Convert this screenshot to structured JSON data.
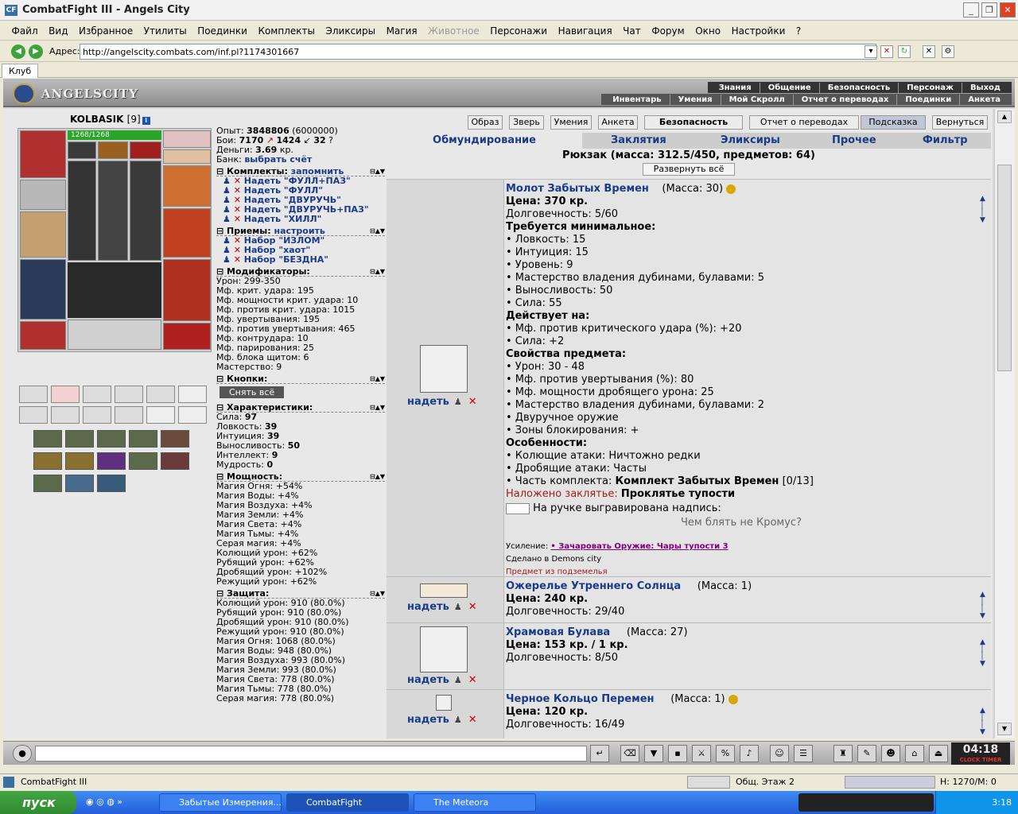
{
  "window": {
    "title": "CombatFight III - Angels City"
  },
  "menu": [
    "Файл",
    "Вид",
    "Избранное",
    "Утилиты",
    "Поединки",
    "Комплекты",
    "Эликсиры",
    "Магия",
    "Животное",
    "Персонажи",
    "Навигация",
    "Чат",
    "Форум",
    "Окно",
    "Настройки",
    "?"
  ],
  "menu_disabled": "Животное",
  "address": {
    "label": "Адрес:",
    "url": "http://angelscity.combats.com/inf.pl?1174301667"
  },
  "tab": "Клуб",
  "logo": "ANGELSCITY",
  "topnav1": [
    "Знания",
    "Общение",
    "Безопасность",
    "Персонаж",
    "Выход"
  ],
  "topnav2": [
    "Инвентарь",
    "Умения",
    "Мой Скролл",
    "Отчет о переводах",
    "Поединки",
    "Анкета"
  ],
  "character": {
    "name": "KOLBASIK",
    "level": "[9]",
    "hp": "1268/1268"
  },
  "stats": {
    "exp_label": "Опыт:",
    "exp": "3848806",
    "exp_next": "(6000000)",
    "fights_label": "Бои:",
    "wins": "7170",
    "losses": "1424",
    "draws": "32",
    "money_label": "Деньги:",
    "money": "3.69",
    "money_unit": "кр.",
    "bank_label": "Банк:",
    "bank_link": "выбрать счёт"
  },
  "kits": {
    "title": "Комплекты:",
    "remember": "запомнить",
    "items": [
      "Надеть \"ФУЛЛ+ПАЗ\"",
      "Надеть \"ФУЛЛ\"",
      "Надеть \"ДВУРУЧЬ\"",
      "Надеть \"ДВУРУЧЬ+ПАЗ\"",
      "Надеть \"ХИЛЛ\""
    ]
  },
  "techniques": {
    "title": "Приемы:",
    "setup": "настроить",
    "items": [
      "Набор \"ИЗЛОМ\"",
      "Набор \"хаот\"",
      "Набор \"БЕЗДНА\""
    ]
  },
  "modifiers": {
    "title": "Модификаторы:",
    "items": [
      "Урон: 299-350",
      "Мф. крит. удара: 195",
      "Мф. мощности крит. удара: 10",
      "Мф. против крит. удара: 1015",
      "Мф. увертывания: 195",
      "Мф. против увертывания: 465",
      "Мф. контрудара: 10",
      "Мф. парирования: 25",
      "Мф. блока щитом: 6",
      "Мастерство: 9"
    ]
  },
  "buttons": {
    "title": "Кнопки:",
    "takeoff": "Снять всё"
  },
  "characteristics": {
    "title": "Характеристики:",
    "items": [
      {
        "k": "Сила:",
        "v": "97"
      },
      {
        "k": "Ловкость:",
        "v": "39"
      },
      {
        "k": "Интуиция:",
        "v": "39"
      },
      {
        "k": "Выносливость:",
        "v": "50"
      },
      {
        "k": "Интеллект:",
        "v": "9"
      },
      {
        "k": "Мудрость:",
        "v": "0"
      }
    ]
  },
  "powers": {
    "title": "Мощность:",
    "items": [
      "Магия Огня: +54%",
      "Магия Воды: +4%",
      "Магия Воздуха: +4%",
      "Магия Земли: +4%",
      "Магия Света: +4%",
      "Магия Тьмы: +4%",
      "Серая магия: +4%",
      "Колющий урон: +62%",
      "Рубящий урон: +62%",
      "Дробящий урон: +102%",
      "Режущий урон: +62%"
    ]
  },
  "protection": {
    "title": "Защита:",
    "items": [
      "Колющий урон: 910 (80.0%)",
      "Рубящий урон: 910 (80.0%)",
      "Дробящий урон: 910 (80.0%)",
      "Режущий урон: 910 (80.0%)",
      "Магия Огня: 1068 (80.0%)",
      "Магия Воды: 948 (80.0%)",
      "Магия Воздуха: 993 (80.0%)",
      "Магия Земли: 993 (80.0%)",
      "Магия Света: 778 (80.0%)",
      "Магия Тьмы: 778 (80.0%)",
      "Серая магия: 778 (80.0%)"
    ]
  },
  "header_buttons": [
    "Образ",
    "Зверь",
    "Умения",
    "Анкета",
    "Безопасность",
    "Отчет о переводах",
    "Подсказка",
    "Вернуться"
  ],
  "inv_tabs": [
    "Обмундирование",
    "Заклятия",
    "Эликсиры",
    "Прочее",
    "Фильтр"
  ],
  "backpack": "Рюкзак (масса: 312.5/450, предметов: 64)",
  "expand": "Развернуть всё",
  "wear_label": "надеть",
  "items": [
    {
      "name": "Молот Забытых Времен",
      "mass": "(Масса: 30)",
      "lines": [
        {
          "t": "Цена: 370 кр.",
          "c": "b"
        },
        {
          "t": "Долговечность: 5/60"
        },
        {
          "t": "Требуется минимальное:",
          "c": "b"
        },
        {
          "t": "• Ловкость: 15"
        },
        {
          "t": "• Интуиция: 15"
        },
        {
          "t": "• Уровень: 9"
        },
        {
          "t": "• Мастерство владения дубинами, булавами: 5"
        },
        {
          "t": "• Выносливость: 50"
        },
        {
          "t": "• Сила: 55"
        },
        {
          "t": "Действует на:",
          "c": "b"
        },
        {
          "t": "• Мф. против критического удара (%): +20"
        },
        {
          "t": "• Сила: +2"
        },
        {
          "t": "Свойства предмета:",
          "c": "b"
        },
        {
          "t": "• Урон: 30 - 48"
        },
        {
          "t": "• Мф. против увертывания (%): 80"
        },
        {
          "t": "• Мф. мощности дробящего урона: 25"
        },
        {
          "t": "• Мастерство владения дубинами, булавами: 2"
        },
        {
          "t": "• Двуручное оружие"
        },
        {
          "t": "• Зоны блокирования: +"
        },
        {
          "t": "Особенности:",
          "c": "b"
        },
        {
          "t": "• Колющие атаки: Ничтожно редки"
        },
        {
          "t": "• Дробящие атаки: Часты"
        }
      ],
      "kit_part_label": "• Часть комплекта:",
      "kit_part": "Комплект Забытых Времен",
      "kit_part_count": "[0/13]",
      "spell_label": "Наложено заклятье:",
      "spell": "Проклятье тупости",
      "engraving_label": "На ручке выгравирована надпись:",
      "engraving": "Чем блять не Кромус?",
      "upgrade_label": "Усиление:",
      "upgrade": "• Зачаровать Оружие: Чары тупости 3",
      "made_in": "Сделано в Demons city",
      "dungeon": "Предмет из подземелья"
    },
    {
      "name": "Ожерелье Утреннего Солнца",
      "mass": "(Масса: 1)",
      "price": "Цена: 240 кр.",
      "durability": "Долговечность: 29/40"
    },
    {
      "name": "Храмовая Булава",
      "mass": "(Масса: 27)",
      "price": "Цена: 153 кр. / 1 кр.",
      "durability": "Долговечность: 8/50"
    },
    {
      "name": "Черное Кольцо Перемен",
      "mass": "(Масса: 1)",
      "price": "Цена: 120 кр.",
      "durability": "Долговечность: 16/49"
    }
  ],
  "clock": {
    "time": "04:18",
    "labels": "CLOCK  TIMER"
  },
  "status": {
    "title": "CombatFight III",
    "location": "Общ. Этаж 2",
    "hm": "H: 1270/M: 0"
  },
  "taskbar": {
    "start": "пуск",
    "tasks": [
      "Забытые Измерения...",
      "CombatFight",
      "The Meteora"
    ],
    "time": "3:18"
  }
}
